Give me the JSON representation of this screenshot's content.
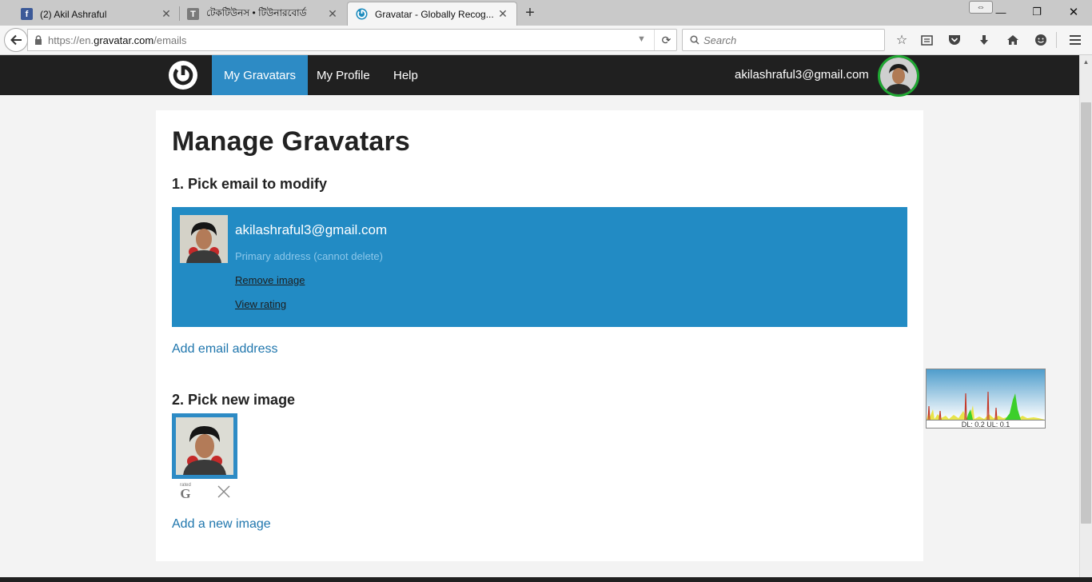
{
  "browser": {
    "tabs": [
      {
        "title": "(2) Akil Ashraful",
        "favicon": "facebook-icon",
        "favicon_color": "#3b5998",
        "favicon_char": "f"
      },
      {
        "title": "টেকটিউনস • টিউনারবোর্ড",
        "favicon": "techtunes-icon",
        "favicon_color": "#7a7a7a",
        "favicon_char": "T"
      },
      {
        "title": "Gravatar - Globally Recog...",
        "favicon": "gravatar-icon",
        "favicon_color": "#1e8cbe",
        "favicon_char": ""
      }
    ],
    "url": {
      "prefix": "https://en.",
      "domain": "gravatar.com",
      "path": "/emails"
    },
    "search_placeholder": "Search"
  },
  "site": {
    "nav": [
      "My Gravatars",
      "My Profile",
      "Help"
    ],
    "user_email": "akilashraful3@gmail.com",
    "colors": {
      "header": "#202020",
      "accent": "#2d8bc5",
      "avatar_ring": "#1fa832",
      "link": "#1f76ad"
    }
  },
  "page": {
    "title": "Manage Gravatars",
    "step1": "1. Pick email to modify",
    "email": {
      "address": "akilashraful3@gmail.com",
      "primary_note": "Primary address (cannot delete)",
      "remove_image": "Remove image",
      "view_rating": "View rating"
    },
    "add_email": "Add email address",
    "step2": "2. Pick new image",
    "image": {
      "rating_small": "rated",
      "rating_letter": "G"
    },
    "add_image": "Add a new image"
  },
  "netmon": {
    "text": "DL: 0.2 UL: 0.1"
  }
}
